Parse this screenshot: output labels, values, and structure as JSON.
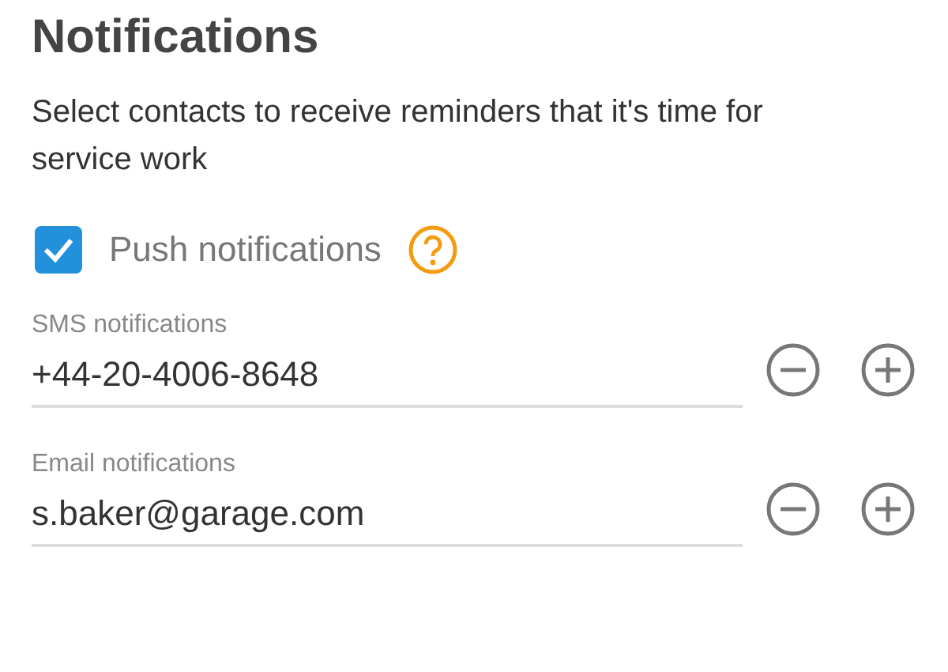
{
  "title": "Notifications",
  "description": "Select contacts to receive reminders that it's time for service work",
  "push": {
    "label": "Push notifications",
    "checked": true
  },
  "fields": [
    {
      "label": "SMS notifications",
      "value": "+44-20-4006-8648"
    },
    {
      "label": "Email notifications",
      "value": "s.baker@garage.com"
    }
  ]
}
